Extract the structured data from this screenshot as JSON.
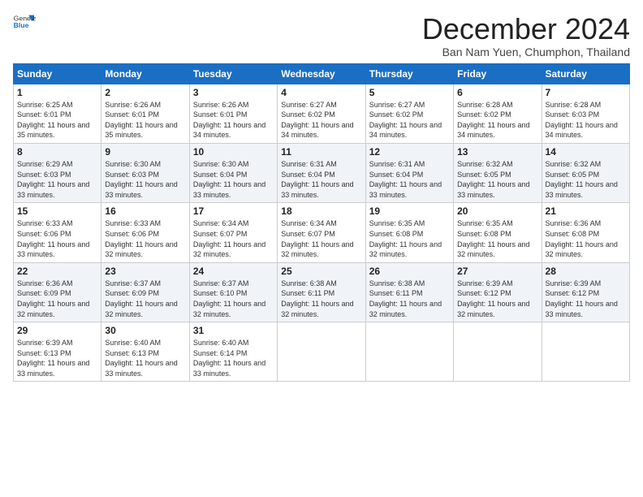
{
  "logo": {
    "general": "General",
    "blue": "Blue"
  },
  "title": "December 2024",
  "subtitle": "Ban Nam Yuen, Chumphon, Thailand",
  "days_of_week": [
    "Sunday",
    "Monday",
    "Tuesday",
    "Wednesday",
    "Thursday",
    "Friday",
    "Saturday"
  ],
  "weeks": [
    [
      {
        "day": "1",
        "sunrise": "6:25 AM",
        "sunset": "6:01 PM",
        "daylight": "11 hours and 35 minutes."
      },
      {
        "day": "2",
        "sunrise": "6:26 AM",
        "sunset": "6:01 PM",
        "daylight": "11 hours and 35 minutes."
      },
      {
        "day": "3",
        "sunrise": "6:26 AM",
        "sunset": "6:01 PM",
        "daylight": "11 hours and 34 minutes."
      },
      {
        "day": "4",
        "sunrise": "6:27 AM",
        "sunset": "6:02 PM",
        "daylight": "11 hours and 34 minutes."
      },
      {
        "day": "5",
        "sunrise": "6:27 AM",
        "sunset": "6:02 PM",
        "daylight": "11 hours and 34 minutes."
      },
      {
        "day": "6",
        "sunrise": "6:28 AM",
        "sunset": "6:02 PM",
        "daylight": "11 hours and 34 minutes."
      },
      {
        "day": "7",
        "sunrise": "6:28 AM",
        "sunset": "6:03 PM",
        "daylight": "11 hours and 34 minutes."
      }
    ],
    [
      {
        "day": "8",
        "sunrise": "6:29 AM",
        "sunset": "6:03 PM",
        "daylight": "11 hours and 33 minutes."
      },
      {
        "day": "9",
        "sunrise": "6:30 AM",
        "sunset": "6:03 PM",
        "daylight": "11 hours and 33 minutes."
      },
      {
        "day": "10",
        "sunrise": "6:30 AM",
        "sunset": "6:04 PM",
        "daylight": "11 hours and 33 minutes."
      },
      {
        "day": "11",
        "sunrise": "6:31 AM",
        "sunset": "6:04 PM",
        "daylight": "11 hours and 33 minutes."
      },
      {
        "day": "12",
        "sunrise": "6:31 AM",
        "sunset": "6:04 PM",
        "daylight": "11 hours and 33 minutes."
      },
      {
        "day": "13",
        "sunrise": "6:32 AM",
        "sunset": "6:05 PM",
        "daylight": "11 hours and 33 minutes."
      },
      {
        "day": "14",
        "sunrise": "6:32 AM",
        "sunset": "6:05 PM",
        "daylight": "11 hours and 33 minutes."
      }
    ],
    [
      {
        "day": "15",
        "sunrise": "6:33 AM",
        "sunset": "6:06 PM",
        "daylight": "11 hours and 33 minutes."
      },
      {
        "day": "16",
        "sunrise": "6:33 AM",
        "sunset": "6:06 PM",
        "daylight": "11 hours and 32 minutes."
      },
      {
        "day": "17",
        "sunrise": "6:34 AM",
        "sunset": "6:07 PM",
        "daylight": "11 hours and 32 minutes."
      },
      {
        "day": "18",
        "sunrise": "6:34 AM",
        "sunset": "6:07 PM",
        "daylight": "11 hours and 32 minutes."
      },
      {
        "day": "19",
        "sunrise": "6:35 AM",
        "sunset": "6:08 PM",
        "daylight": "11 hours and 32 minutes."
      },
      {
        "day": "20",
        "sunrise": "6:35 AM",
        "sunset": "6:08 PM",
        "daylight": "11 hours and 32 minutes."
      },
      {
        "day": "21",
        "sunrise": "6:36 AM",
        "sunset": "6:08 PM",
        "daylight": "11 hours and 32 minutes."
      }
    ],
    [
      {
        "day": "22",
        "sunrise": "6:36 AM",
        "sunset": "6:09 PM",
        "daylight": "11 hours and 32 minutes."
      },
      {
        "day": "23",
        "sunrise": "6:37 AM",
        "sunset": "6:09 PM",
        "daylight": "11 hours and 32 minutes."
      },
      {
        "day": "24",
        "sunrise": "6:37 AM",
        "sunset": "6:10 PM",
        "daylight": "11 hours and 32 minutes."
      },
      {
        "day": "25",
        "sunrise": "6:38 AM",
        "sunset": "6:11 PM",
        "daylight": "11 hours and 32 minutes."
      },
      {
        "day": "26",
        "sunrise": "6:38 AM",
        "sunset": "6:11 PM",
        "daylight": "11 hours and 32 minutes."
      },
      {
        "day": "27",
        "sunrise": "6:39 AM",
        "sunset": "6:12 PM",
        "daylight": "11 hours and 32 minutes."
      },
      {
        "day": "28",
        "sunrise": "6:39 AM",
        "sunset": "6:12 PM",
        "daylight": "11 hours and 33 minutes."
      }
    ],
    [
      {
        "day": "29",
        "sunrise": "6:39 AM",
        "sunset": "6:13 PM",
        "daylight": "11 hours and 33 minutes."
      },
      {
        "day": "30",
        "sunrise": "6:40 AM",
        "sunset": "6:13 PM",
        "daylight": "11 hours and 33 minutes."
      },
      {
        "day": "31",
        "sunrise": "6:40 AM",
        "sunset": "6:14 PM",
        "daylight": "11 hours and 33 minutes."
      },
      null,
      null,
      null,
      null
    ]
  ]
}
